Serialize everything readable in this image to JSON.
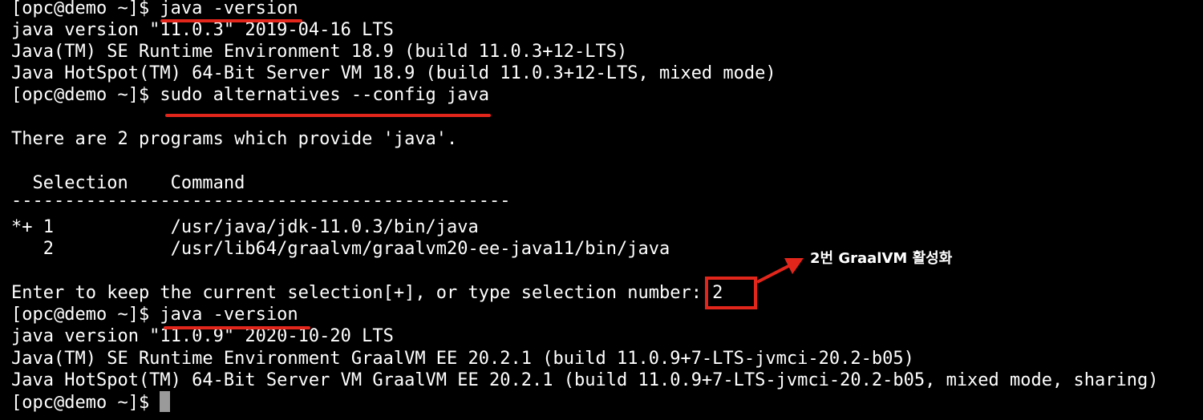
{
  "terminal": {
    "lines": [
      "[opc@demo ~]$ java -version",
      "java version \"11.0.3\" 2019-04-16 LTS",
      "Java(TM) SE Runtime Environment 18.9 (build 11.0.3+12-LTS)",
      "Java HotSpot(TM) 64-Bit Server VM 18.9 (build 11.0.3+12-LTS, mixed mode)",
      "[opc@demo ~]$ sudo alternatives --config java",
      "",
      "There are 2 programs which provide 'java'.",
      "",
      "  Selection    Command",
      "-----------------------------------------------",
      "*+ 1           /usr/java/jdk-11.0.3/bin/java",
      "   2           /usr/lib64/graalvm/graalvm20-ee-java11/bin/java",
      "",
      "Enter to keep the current selection[+], or type selection number: 2",
      "[opc@demo ~]$ java -version",
      "java version \"11.0.9\" 2020-10-20 LTS",
      "Java(TM) SE Runtime Environment GraalVM EE 20.2.1 (build 11.0.9+7-LTS-jvmci-20.2-b05)",
      "Java HotSpot(TM) 64-Bit Server VM GraalVM EE 20.2.1 (build 11.0.9+7-LTS-jvmci-20.2-b05, mixed mode, sharing)",
      "[opc@demo ~]$ "
    ]
  },
  "annotation": {
    "text": "2번 GraalVM 활성화"
  },
  "colors": {
    "background": "#000000",
    "text": "#ffffff",
    "highlight": "#e3261c",
    "cursor": "#9a9a9a"
  }
}
